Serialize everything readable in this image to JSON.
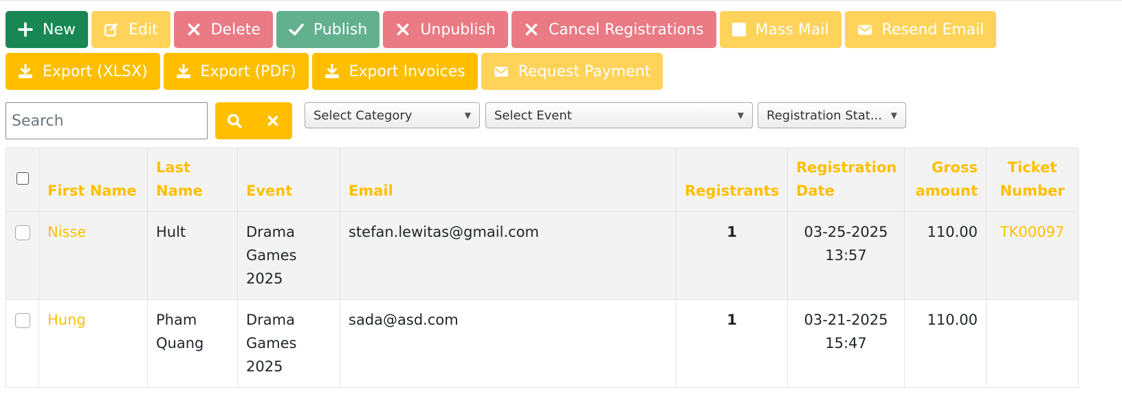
{
  "toolbar": {
    "new_label": "New",
    "edit_label": "Edit",
    "delete_label": "Delete",
    "publish_label": "Publish",
    "unpublish_label": "Unpublish",
    "cancel_registrations_label": "Cancel Registrations",
    "mass_mail_label": "Mass Mail",
    "resend_email_label": "Resend Email",
    "export_xlsx_label": "Export (XLSX)",
    "export_pdf_label": "Export (PDF)",
    "export_invoices_label": "Export Invoices",
    "request_payment_label": "Request Payment"
  },
  "filters": {
    "search_placeholder": "Search",
    "search_value": "",
    "category_selected": "Select Category",
    "event_selected": "Select Event",
    "status_selected": "Registration Stat..."
  },
  "table": {
    "headers": {
      "first_name": "First Name",
      "last_name": "Last Name",
      "event": "Event",
      "email": "Email",
      "registrants": "Registrants",
      "registration_date": "Registration Date",
      "gross_amount": "Gross amount",
      "ticket_number": "Ticket Number"
    },
    "rows": [
      {
        "first_name": "Nisse",
        "last_name": "Hult",
        "event": "Drama Games 2025",
        "email": "stefan.lewitas@gmail.com",
        "registrants": "1",
        "registration_date": "03-25-2025 13:57",
        "gross_amount": "110.00",
        "ticket_number": "TK00097"
      },
      {
        "first_name": "Hung",
        "last_name": "Pham Quang",
        "event": "Drama Games 2025",
        "email": "sada@asd.com",
        "registrants": "1",
        "registration_date": "03-21-2025 15:47",
        "gross_amount": "110.00",
        "ticket_number": ""
      }
    ]
  },
  "colors": {
    "accent": "#ffbf00",
    "success": "#198754",
    "danger_soft": "#ea7a84",
    "success_soft": "#63b08f",
    "warning_soft": "#ffd35a"
  },
  "icons": {
    "new": "plus-icon",
    "edit": "edit-icon",
    "delete": "close-icon",
    "publish": "check-icon",
    "unpublish": "close-icon",
    "cancel": "close-icon",
    "mass_mail": "checkbox-icon",
    "resend": "envelope-icon",
    "export": "download-icon",
    "request_payment": "envelope-icon",
    "search": "search-icon",
    "clear": "close-icon"
  }
}
